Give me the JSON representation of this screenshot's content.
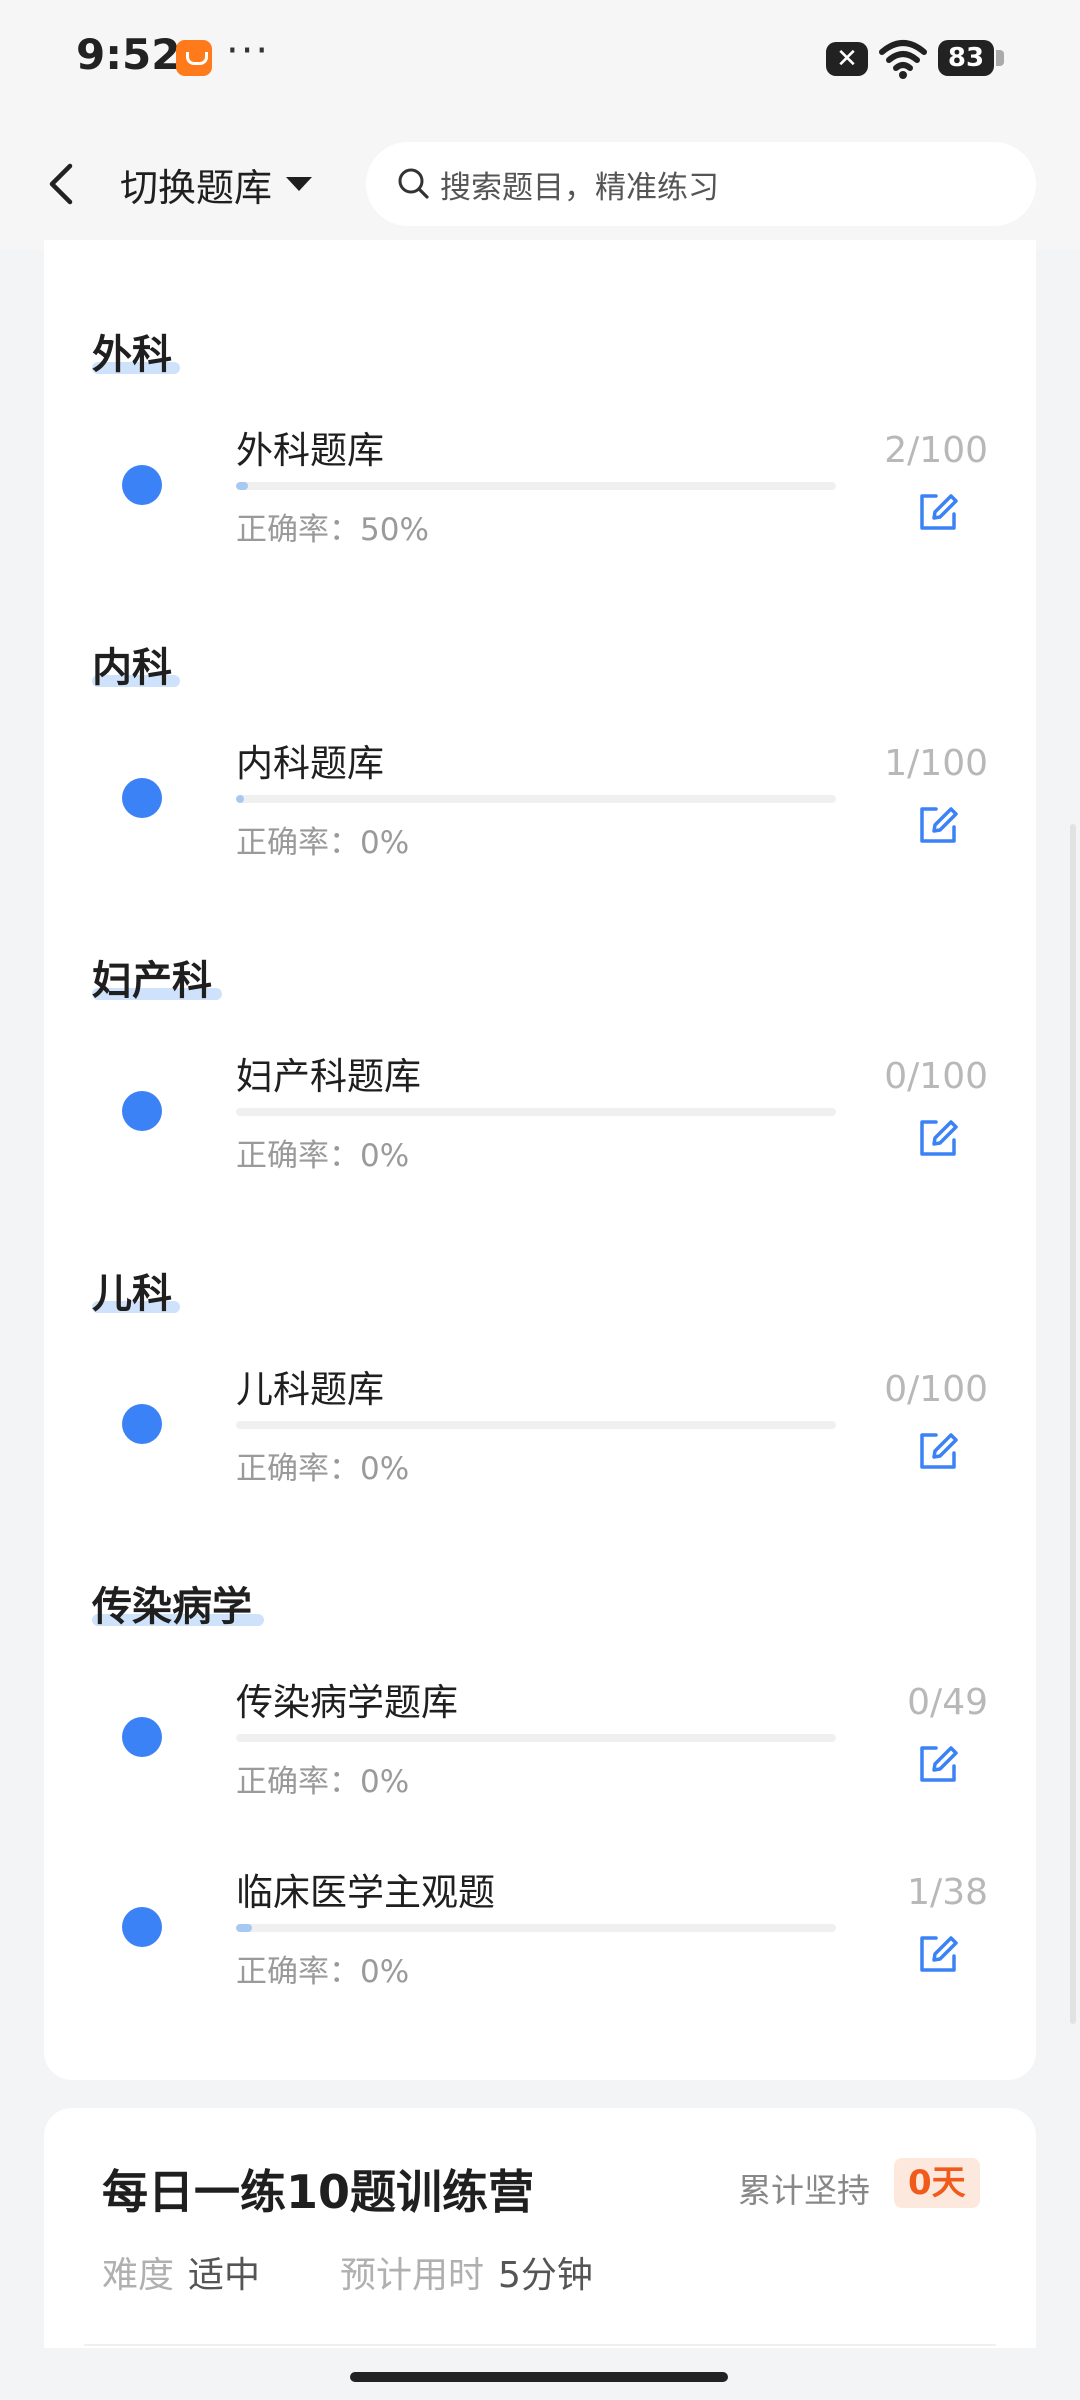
{
  "status_bar": {
    "time": "9:52",
    "app_icon": "taobao-icon",
    "dots": "···",
    "battery": "83",
    "close_badge": "✕"
  },
  "nav": {
    "switch_label": "切换题库",
    "search_placeholder": "搜索题目，精准练习"
  },
  "colors": {
    "accent": "#3b82f6",
    "progress_fill": "#a7c8f0",
    "streak_text": "#f05a1a",
    "streak_bg": "#fde8dd"
  },
  "sections": [
    {
      "title": "外科",
      "items": [
        {
          "name": "外科题库",
          "accuracy": "正确率：50%",
          "count": "2/100",
          "progress": 0.02
        }
      ]
    },
    {
      "title": "内科",
      "items": [
        {
          "name": "内科题库",
          "accuracy": "正确率：0%",
          "count": "1/100",
          "progress": 0.01
        }
      ]
    },
    {
      "title": "妇产科",
      "items": [
        {
          "name": "妇产科题库",
          "accuracy": "正确率：0%",
          "count": "0/100",
          "progress": 0
        }
      ]
    },
    {
      "title": "儿科",
      "items": [
        {
          "name": "儿科题库",
          "accuracy": "正确率：0%",
          "count": "0/100",
          "progress": 0
        }
      ]
    },
    {
      "title": "传染病学",
      "items": [
        {
          "name": "传染病学题库",
          "accuracy": "正确率：0%",
          "count": "0/49",
          "progress": 0
        },
        {
          "name": "临床医学主观题",
          "accuracy": "正确率：0%",
          "count": "1/38",
          "progress": 0.026
        }
      ]
    }
  ],
  "camp": {
    "title": "每日一练10题训练营",
    "streak_label": "累计坚持",
    "streak_value": "0天",
    "difficulty_label": "难度",
    "difficulty_value": "适中",
    "time_label": "预计用时",
    "time_value": "5分钟"
  }
}
